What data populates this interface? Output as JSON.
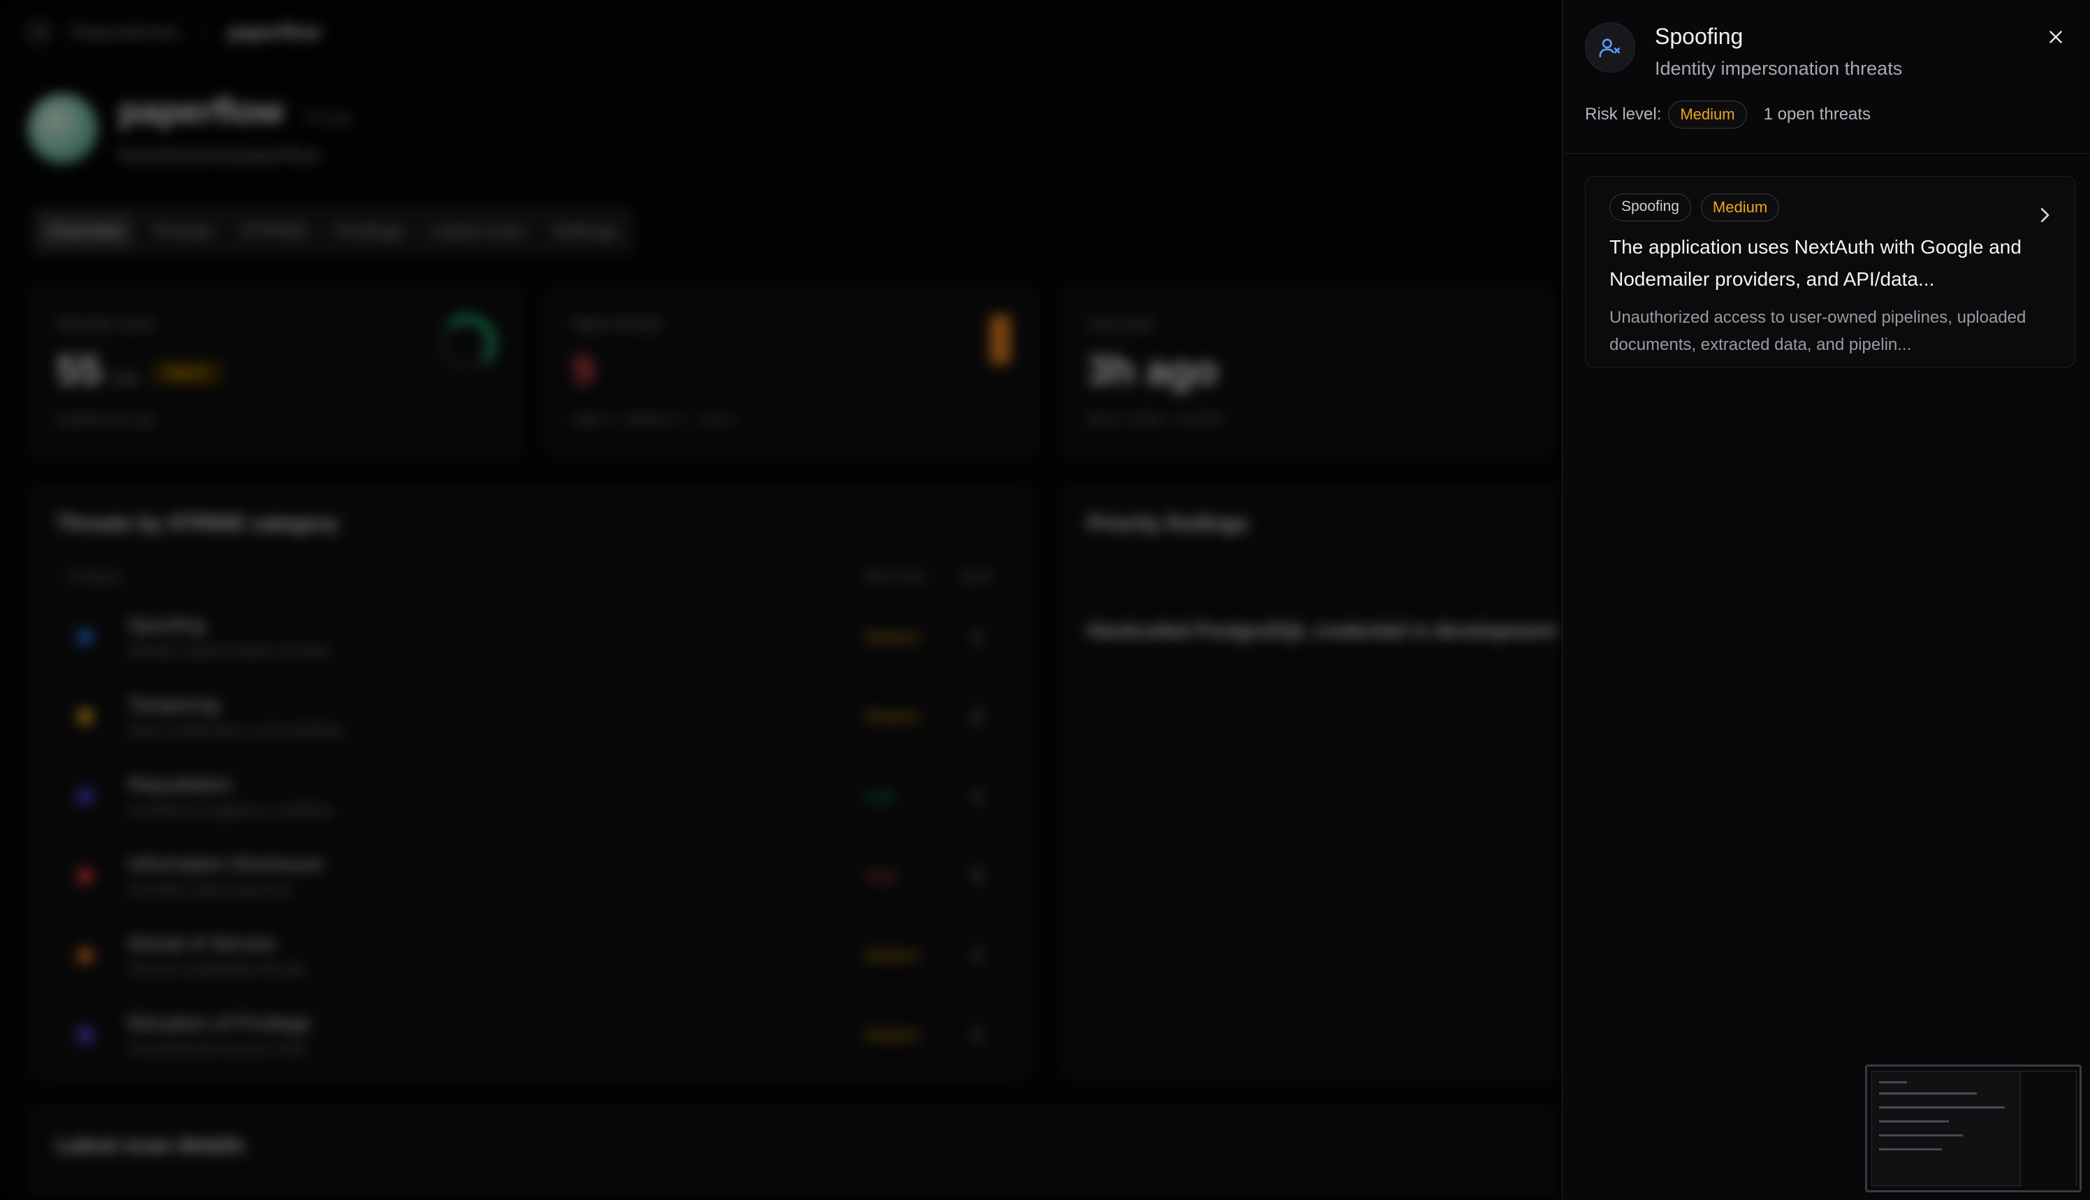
{
  "background": {
    "breadcrumb": [
      "Repositories",
      "paperflow"
    ],
    "repo": {
      "name": "paperflow",
      "visibility": "Private",
      "slug": "branderberto/paperflow"
    },
    "tabs": [
      "Overview",
      "Threats",
      "STRIDE",
      "Findings",
      "Latest scan",
      "Settings"
    ],
    "stats": [
      {
        "label": "Security score",
        "value": "55",
        "suffix": "/100",
        "tag": "Watch",
        "sub": "Updated 3h ago"
      },
      {
        "label": "Open threats",
        "value": "9",
        "sub": "High 1 · Medium 7 · Low 1"
      },
      {
        "label": "Last scan",
        "value": "3h ago",
        "sub": "Mar 5, 2026, 7:30 PM"
      }
    ],
    "stride_panel_title": "Threats by STRIDE category",
    "stride_columns": [
      "Category",
      "Risk level",
      "Open"
    ],
    "stride_rows": [
      {
        "name": "Spoofing",
        "desc": "Identity impersonation threats",
        "risk": "Medium",
        "count": "1",
        "color": "#1e6fd9"
      },
      {
        "name": "Tampering",
        "desc": "Data modification vulnerabilities",
        "risk": "Medium",
        "count": "2",
        "color": "#d99a1e"
      },
      {
        "name": "Repudiation",
        "desc": "Insufficient logging or auditing",
        "risk": "Low",
        "count": "1",
        "color": "#4a3fd9"
      },
      {
        "name": "Information Disclosure",
        "desc": "Sensitive data exposure",
        "risk": "High",
        "count": "3",
        "color": "#d93a3a"
      },
      {
        "name": "Denial of Service",
        "desc": "Service availability threats",
        "risk": "Medium",
        "count": "1",
        "color": "#d96a1e"
      },
      {
        "name": "Elevation of Privilege",
        "desc": "Unauthorized access risks",
        "risk": "Medium",
        "count": "1",
        "color": "#5a3fd9"
      }
    ],
    "priority_panel_title": "Priority findings",
    "priority_title": "Hardcoded PostgreSQL credential in development E",
    "latest_scan_title": "Latest scan details"
  },
  "sheet": {
    "title": "Spoofing",
    "subtitle": "Identity impersonation threats",
    "risk_label": "Risk level:",
    "risk_value": "Medium",
    "open_threats": "1 open threats",
    "card": {
      "category": "Spoofing",
      "severity": "Medium",
      "title": "The application uses NextAuth with Google and Nodemailer providers, and API/data...",
      "description": "Unauthorized access to user-owned pipelines, uploaded documents, extracted data, and pipelin..."
    }
  },
  "colors": {
    "medium": "#f0a51c",
    "icon_blue": "#5aa0ff",
    "panel_bg": "#08080a"
  },
  "icons": [
    "user-x-icon",
    "close-icon",
    "chevron-right-icon"
  ]
}
